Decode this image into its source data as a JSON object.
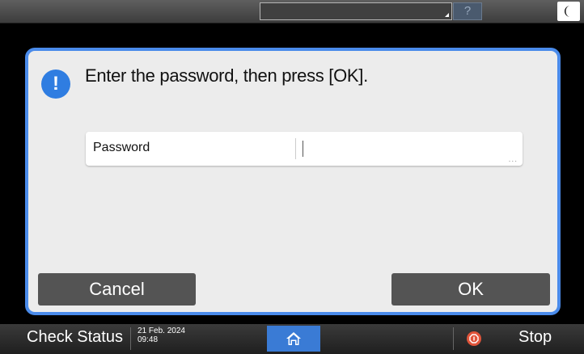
{
  "top": {
    "help_label": "?",
    "icons": {
      "eco": "moon-icon",
      "help": "question-icon"
    }
  },
  "dialog": {
    "message": "Enter the password, then press [OK].",
    "password_label": "Password",
    "password_value": "",
    "ellipsis": "...",
    "cancel_label": "Cancel",
    "ok_label": "OK",
    "icon": "info-exclamation-icon",
    "info_icon_glyph": "!"
  },
  "bottom": {
    "check_status_label": "Check Status",
    "date": "21 Feb. 2024",
    "time": "09:48",
    "stop_label": "Stop",
    "icons": {
      "home": "home-icon",
      "stop": "stop-icon"
    }
  },
  "colors": {
    "accent": "#4a8bea",
    "info": "#2f7de1",
    "button": "#545454",
    "home": "#3a7bd5",
    "stop": "#e0543a"
  }
}
